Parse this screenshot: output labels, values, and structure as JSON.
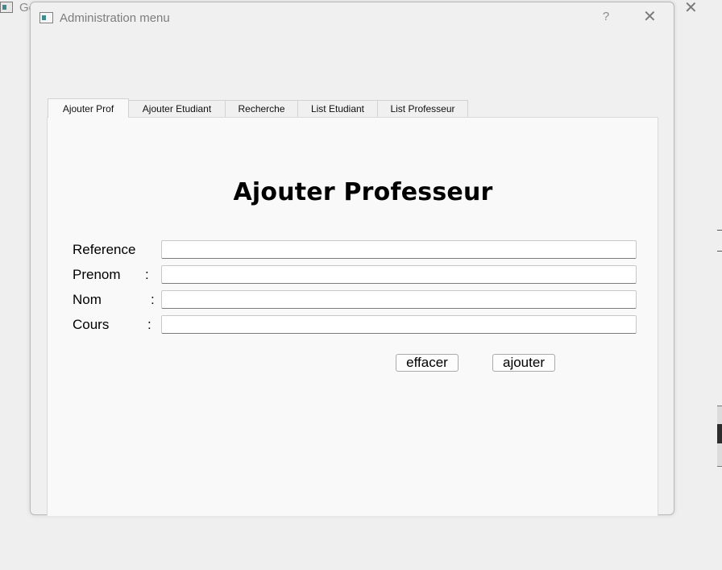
{
  "background_window": {
    "title": "Ge"
  },
  "dialog": {
    "title": "Administration menu",
    "help_label": "?",
    "close_label": "✕"
  },
  "tabs": [
    {
      "label": "Ajouter Prof",
      "active": true
    },
    {
      "label": "Ajouter Etudiant",
      "active": false
    },
    {
      "label": "Recherche",
      "active": false
    },
    {
      "label": "List Etudiant",
      "active": false
    },
    {
      "label": "List Professeur",
      "active": false
    }
  ],
  "form": {
    "title": "Ajouter Professeur",
    "fields": [
      {
        "label": "Reference",
        "colon": "",
        "value": ""
      },
      {
        "label": "Prenom",
        "colon": ":",
        "value": ""
      },
      {
        "label": "Nom",
        "colon": ":",
        "value": ""
      },
      {
        "label": "Cours",
        "colon": ":",
        "value": ""
      }
    ],
    "clear_button": "effacer",
    "add_button": "ajouter"
  }
}
